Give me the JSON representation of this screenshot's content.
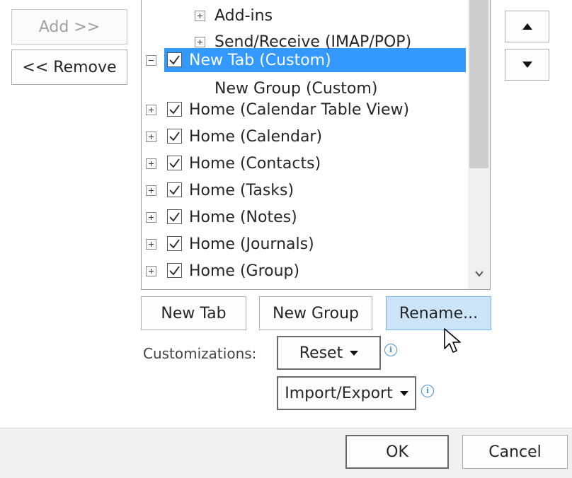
{
  "left_buttons": {
    "add": "Add >>",
    "remove": "<< Remove"
  },
  "tree": {
    "rows": [
      {
        "label": "Add-ins",
        "expander": "plus",
        "checkbox": false,
        "selected": false
      },
      {
        "label": "Send/Receive (IMAP/POP)",
        "expander": "plus",
        "checkbox": false,
        "selected": false
      },
      {
        "label": "New Tab (Custom)",
        "expander": "minus",
        "checkbox": true,
        "selected": true
      },
      {
        "label": "New Group (Custom)",
        "expander": null,
        "checkbox": false,
        "selected": false
      },
      {
        "label": "Home (Calendar Table View)",
        "expander": "plus",
        "checkbox": true,
        "selected": false
      },
      {
        "label": "Home (Calendar)",
        "expander": "plus",
        "checkbox": true,
        "selected": false
      },
      {
        "label": "Home (Contacts)",
        "expander": "plus",
        "checkbox": true,
        "selected": false
      },
      {
        "label": "Home (Tasks)",
        "expander": "plus",
        "checkbox": true,
        "selected": false
      },
      {
        "label": "Home (Notes)",
        "expander": "plus",
        "checkbox": true,
        "selected": false
      },
      {
        "label": "Home (Journals)",
        "expander": "plus",
        "checkbox": true,
        "selected": false
      },
      {
        "label": "Home (Group)",
        "expander": "plus",
        "checkbox": true,
        "selected": false
      }
    ]
  },
  "actions": {
    "new_tab": "New Tab",
    "new_group": "New Group",
    "rename": "Rename..."
  },
  "customizations": {
    "label": "Customizations:",
    "reset": "Reset",
    "import_export": "Import/Export"
  },
  "footer": {
    "ok": "OK",
    "cancel": "Cancel"
  },
  "colors": {
    "selection": "#3399ff",
    "hover_button": "#cce4f7",
    "info": "#4a90d9"
  },
  "icons": [
    "move-up-icon",
    "move-down-icon",
    "info-icon",
    "mouse-cursor-icon",
    "scroll-down-icon",
    "checkmark-icon",
    "expand-icon",
    "collapse-icon"
  ]
}
